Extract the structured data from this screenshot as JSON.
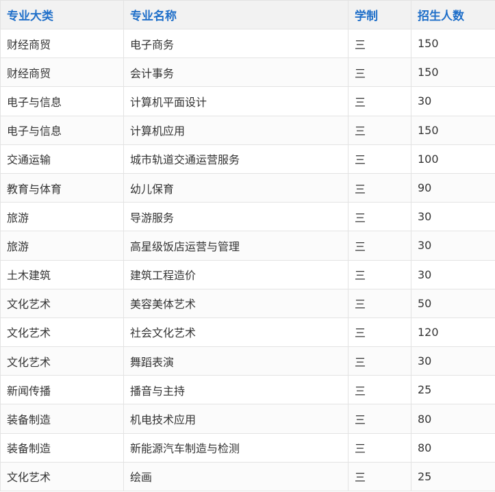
{
  "table": {
    "headers": [
      "专业大类",
      "专业名称",
      "学制",
      "招生人数"
    ],
    "rows": [
      [
        "财经商贸",
        "电子商务",
        "三",
        "150"
      ],
      [
        "财经商贸",
        "会计事务",
        "三",
        "150"
      ],
      [
        "电子与信息",
        "计算机平面设计",
        "三",
        "30"
      ],
      [
        "电子与信息",
        "计算机应用",
        "三",
        "150"
      ],
      [
        "交通运输",
        "城市轨道交通运营服务",
        "三",
        "100"
      ],
      [
        "教育与体育",
        "幼儿保育",
        "三",
        "90"
      ],
      [
        "旅游",
        "导游服务",
        "三",
        "30"
      ],
      [
        "旅游",
        "高星级饭店运营与管理",
        "三",
        "30"
      ],
      [
        "土木建筑",
        "建筑工程造价",
        "三",
        "30"
      ],
      [
        "文化艺术",
        "美容美体艺术",
        "三",
        "50"
      ],
      [
        "文化艺术",
        "社会文化艺术",
        "三",
        "120"
      ],
      [
        "文化艺术",
        "舞蹈表演",
        "三",
        "30"
      ],
      [
        "新闻传播",
        "播音与主持",
        "三",
        "25"
      ],
      [
        "装备制造",
        "机电技术应用",
        "三",
        "80"
      ],
      [
        "装备制造",
        "新能源汽车制造与检测",
        "三",
        "80"
      ],
      [
        "文化艺术",
        "绘画",
        "三",
        "25"
      ]
    ]
  },
  "colors": {
    "header_text": "#1f6fc9",
    "header_bg": "#f2f2f2",
    "border": "#e3e3e3",
    "body_text": "#333333"
  }
}
